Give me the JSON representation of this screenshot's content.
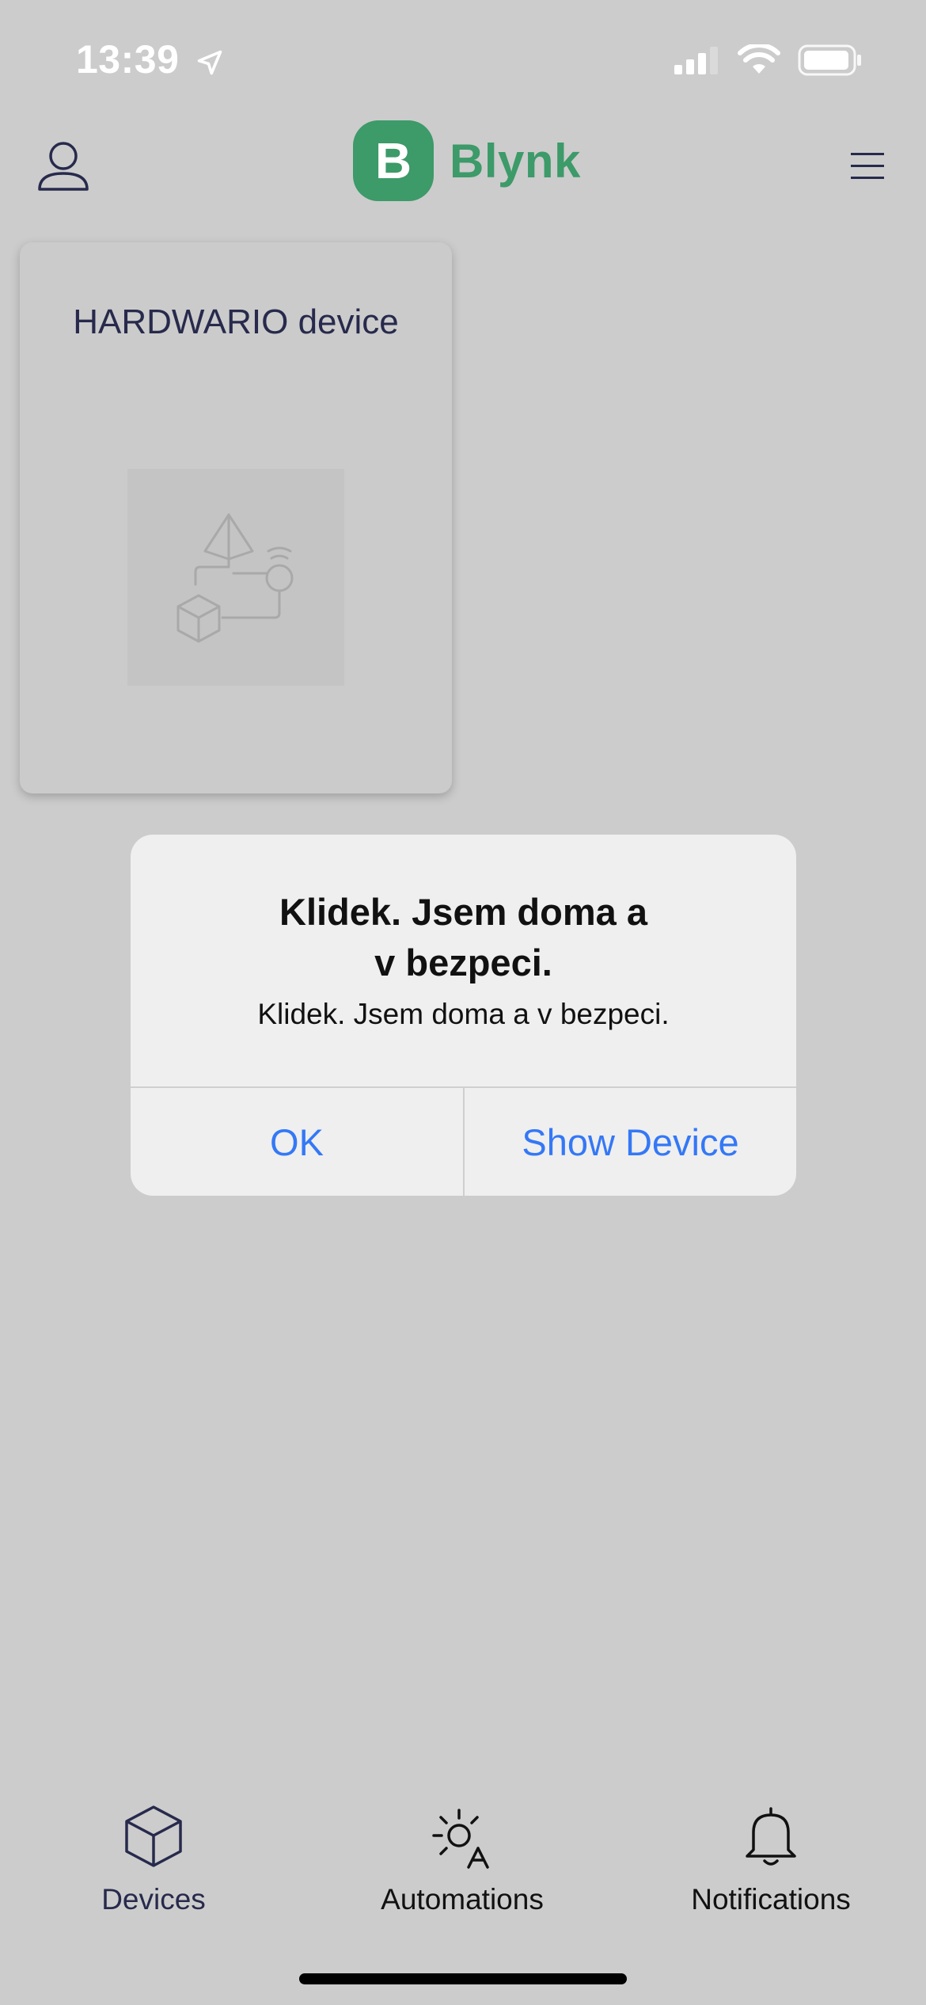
{
  "status_bar": {
    "time": "13:39"
  },
  "header": {
    "logo_letter": "B",
    "logo_text": "Blynk"
  },
  "device_card": {
    "name": "HARDWARIO device"
  },
  "alert": {
    "title_line1": "Klidek. Jsem doma a",
    "title_line2": "v bezpeci.",
    "message": "Klidek. Jsem doma a v bezpeci.",
    "ok_label": "OK",
    "show_label": "Show Device"
  },
  "tabs": [
    {
      "label": "Devices",
      "icon": "cube-icon"
    },
    {
      "label": "Automations",
      "icon": "sun-automation-icon"
    },
    {
      "label": "Notifications",
      "icon": "bell-icon"
    }
  ],
  "colors": {
    "background": "#cccccc",
    "brand": "#3d9a69",
    "link": "#3478f6",
    "navy": "#272a4c"
  }
}
